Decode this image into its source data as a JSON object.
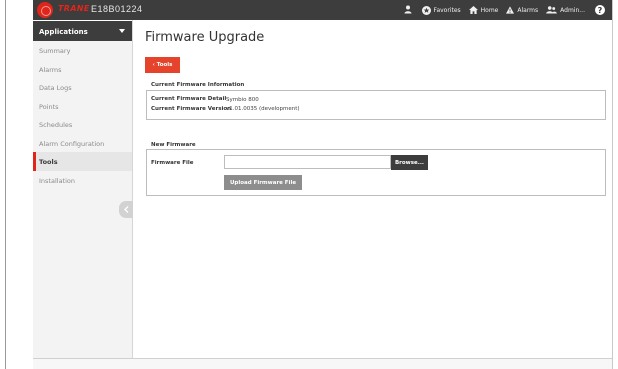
{
  "topbar": {
    "brand": "TRANE",
    "device_id": "E18B01224",
    "nav": [
      {
        "label": "Favorites",
        "icon": "star-icon"
      },
      {
        "label": "Home",
        "icon": "home-icon"
      },
      {
        "label": "Alarms",
        "icon": "alarm-icon"
      },
      {
        "label": "Admin...",
        "icon": "users-icon"
      }
    ],
    "help_label": "?"
  },
  "sidebar": {
    "header": "Applications",
    "items": [
      {
        "label": "Summary"
      },
      {
        "label": "Alarms"
      },
      {
        "label": "Data Logs"
      },
      {
        "label": "Points"
      },
      {
        "label": "Schedules"
      },
      {
        "label": "Alarm Configuration"
      },
      {
        "label": "Tools",
        "active": true
      },
      {
        "label": "Installation"
      }
    ]
  },
  "main": {
    "title": "Firmware Upgrade",
    "back_button": "‹  Tools",
    "current": {
      "heading": "Current Firmware Information",
      "detail_label": "Current Firmware Detail",
      "detail_value": "Symbio 800",
      "version_label": "Current Firmware Version",
      "version_value": "v1.01.0035 (development)"
    },
    "new": {
      "heading": "New Firmware",
      "file_label": "Firmware File",
      "file_value": "",
      "browse_label": "Browse...",
      "upload_label": "Upload Firmware File"
    }
  },
  "colors": {
    "accent": "#e1251b",
    "button_red": "#e5432b",
    "topbar": "#3d3d3d",
    "disabled_button": "#8d8d8d"
  }
}
